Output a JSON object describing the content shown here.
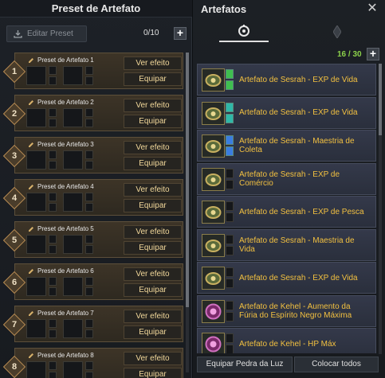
{
  "left_panel": {
    "title": "Preset de Artefato",
    "edit_button_label": "Editar Preset",
    "preset_count": "0/10",
    "add_label": "+",
    "presets": [
      {
        "number": "1",
        "name": "Preset de Artefato 1",
        "view_label": "Ver efeito",
        "equip_label": "Equipar"
      },
      {
        "number": "2",
        "name": "Preset de Artefato 2",
        "view_label": "Ver efeito",
        "equip_label": "Equipar"
      },
      {
        "number": "3",
        "name": "Preset de Artefato 3",
        "view_label": "Ver efeito",
        "equip_label": "Equipar"
      },
      {
        "number": "4",
        "name": "Preset de Artefato 4",
        "view_label": "Ver efeito",
        "equip_label": "Equipar"
      },
      {
        "number": "5",
        "name": "Preset de Artefato 5",
        "view_label": "Ver efeito",
        "equip_label": "Equipar"
      },
      {
        "number": "6",
        "name": "Preset de Artefato 6",
        "view_label": "Ver efeito",
        "equip_label": "Equipar"
      },
      {
        "number": "7",
        "name": "Preset de Artefato 7",
        "view_label": "Ver efeito",
        "equip_label": "Equipar"
      },
      {
        "number": "8",
        "name": "Preset de Artefato 8",
        "view_label": "Ver efeito",
        "equip_label": "Equipar"
      }
    ]
  },
  "right_panel": {
    "title": "Artefatos",
    "close_label": "✕",
    "tabs": [
      {
        "icon": "artifact-icon",
        "active": true
      },
      {
        "icon": "lightstone-icon",
        "active": false
      }
    ],
    "count": "16 / 30",
    "add_label": "+",
    "artifacts": [
      {
        "name": "Artefato de Sesrah - EXP de Vida",
        "icon": "sesrah-artifact-icon",
        "gem": "green"
      },
      {
        "name": "Artefato de Sesrah - EXP de Vida",
        "icon": "sesrah-artifact-icon",
        "gem": "teal"
      },
      {
        "name": "Artefato de Sesrah - Maestria de Coleta",
        "icon": "sesrah-artifact-icon",
        "gem": "blue"
      },
      {
        "name": "Artefato de Sesrah - EXP de Comércio",
        "icon": "sesrah-artifact-icon",
        "gem": "none"
      },
      {
        "name": "Artefato de Sesrah - EXP de Pesca",
        "icon": "sesrah-artifact-icon",
        "gem": "none"
      },
      {
        "name": "Artefato de Sesrah - Maestria de Vida",
        "icon": "sesrah-artifact-icon",
        "gem": "none"
      },
      {
        "name": "Artefato de Sesrah - EXP de Vida",
        "icon": "sesrah-artifact-icon",
        "gem": "none"
      },
      {
        "name": "Artefato de Kehel - Aumento da Fúria do Espírito Negro Máxima",
        "icon": "kehel-artifact-icon",
        "gem": "none"
      },
      {
        "name": "Artefato de Kehel - HP Máx",
        "icon": "kehel-artifact-icon",
        "gem": "none"
      }
    ],
    "equip_lightstone_label": "Equipar Pedra da Luz",
    "place_all_label": "Colocar todos"
  },
  "colors": {
    "artifact_name": "#f2c040",
    "count_green": "#8bd14a",
    "button_text": "#f2d89a"
  }
}
